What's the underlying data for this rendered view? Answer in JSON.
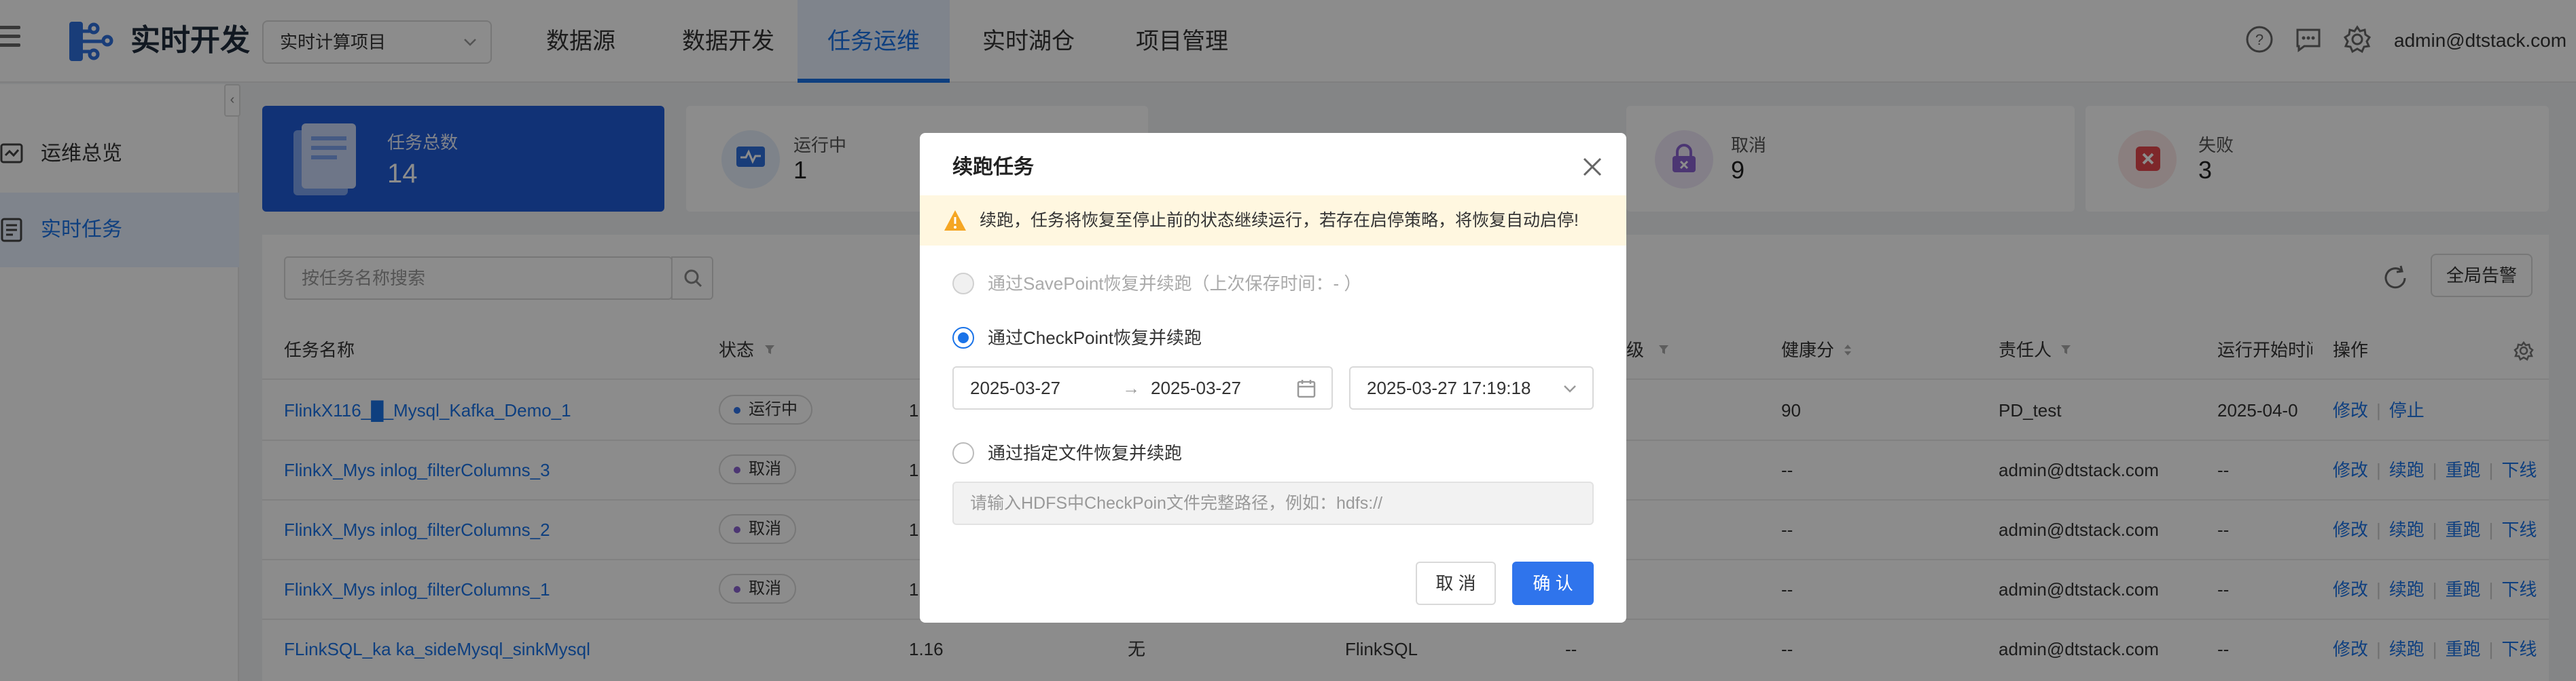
{
  "header": {
    "app_title": "实时开发",
    "project_select": "实时计算项目",
    "nav": [
      {
        "label": "数据源"
      },
      {
        "label": "数据开发"
      },
      {
        "label": "任务运维"
      },
      {
        "label": "实时湖仓"
      },
      {
        "label": "项目管理"
      }
    ],
    "active_nav": "任务运维",
    "user": "admin@dtstack.com",
    "icons": [
      "help-icon",
      "message-icon",
      "settings-icon"
    ]
  },
  "sidebar": {
    "items": [
      {
        "label": "运维总览"
      },
      {
        "label": "实时任务"
      }
    ],
    "active": "实时任务"
  },
  "stats": {
    "total": {
      "label": "任务总数",
      "value": "14"
    },
    "running": {
      "label": "运行中",
      "value": "1"
    },
    "cancelled": {
      "label": "取消",
      "value": "9"
    },
    "failed": {
      "label": "失败",
      "value": "3"
    }
  },
  "toolbar": {
    "search_placeholder": "按任务名称搜索",
    "alert_button": "全局告警"
  },
  "table": {
    "headers": {
      "name": "任务名称",
      "status": "状态",
      "level": "级",
      "health": "健康分",
      "owner": "责任人",
      "start_time": "运行开始时间",
      "ops": "操作"
    },
    "rows": [
      {
        "name": "FlinkX116_█_Mysql_Kafka_Demo_1",
        "status": "运行中",
        "status_color": "#2f74ec",
        "c3": "1",
        "c4": "",
        "c5": "",
        "c6": "",
        "health": "90",
        "owner": "PD_test",
        "start": "2025-04-0",
        "ops": [
          "修改",
          "停止"
        ]
      },
      {
        "name": "FlinkX_Mys inlog_filterColumns_3",
        "status": "取消",
        "status_color": "#8a63d2",
        "c3": "1",
        "c4": "",
        "c5": "",
        "c6": "",
        "health": "--",
        "owner": "admin@dtstack.com",
        "start": "--",
        "ops": [
          "修改",
          "续跑",
          "重跑",
          "下线"
        ]
      },
      {
        "name": "FlinkX_Mys inlog_filterColumns_2",
        "status": "取消",
        "status_color": "#8a63d2",
        "c3": "1",
        "c4": "",
        "c5": "",
        "c6": "",
        "health": "--",
        "owner": "admin@dtstack.com",
        "start": "--",
        "ops": [
          "修改",
          "续跑",
          "重跑",
          "下线"
        ]
      },
      {
        "name": "FlinkX_Mys inlog_filterColumns_1",
        "status": "取消",
        "status_color": "#8a63d2",
        "c3": "1",
        "c4": "",
        "c5": "",
        "c6": "",
        "health": "--",
        "owner": "admin@dtstack.com",
        "start": "--",
        "ops": [
          "修改",
          "续跑",
          "重跑",
          "下线"
        ]
      },
      {
        "name": "FLinkSQL_ka ka_sideMysql_sinkMysql",
        "status": "",
        "status_color": "",
        "c3": "1.16",
        "c4": "无",
        "c5": "FlinkSQL",
        "c6": "--",
        "health": "--",
        "owner": "admin@dtstack.com",
        "start": "--",
        "ops": [
          "修改",
          "续跑",
          "重跑",
          "下线"
        ]
      }
    ]
  },
  "modal": {
    "title": "续跑任务",
    "warning": "续跑，任务将恢复至停止前的状态继续运行，若存在启停策略，将恢复自动启停!",
    "option_savepoint": "通过SavePoint恢复并续跑（上次保存时间：- ）",
    "option_checkpoint": "通过CheckPoint恢复并续跑",
    "option_file": "通过指定文件恢复并续跑",
    "date_start": "2025-03-27",
    "date_end": "2025-03-27",
    "date_arrow": "→",
    "checkpoint_time": "2025-03-27 17:19:18",
    "path_placeholder": "请输入HDFS中CheckPoin文件完整路径，例如：hdfs://",
    "cancel": "取 消",
    "confirm": "确 认"
  }
}
